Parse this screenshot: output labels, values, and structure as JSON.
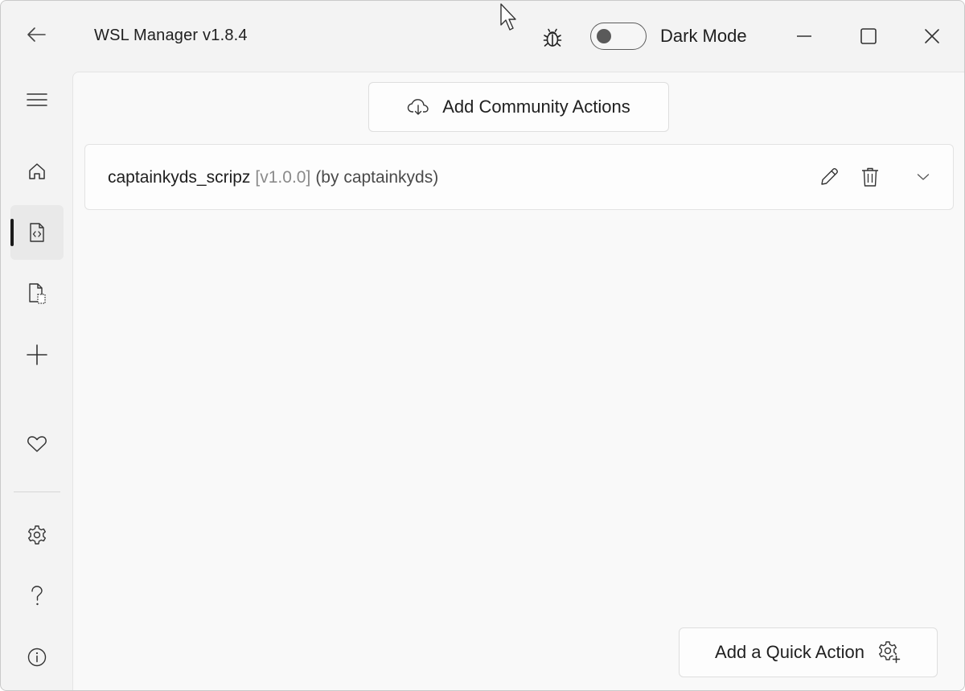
{
  "window": {
    "title": "WSL Manager v1.8.4"
  },
  "header": {
    "dark_mode_label": "Dark Mode",
    "dark_mode_on": false
  },
  "sidebar": {
    "items": [
      {
        "name": "menu",
        "icon": "hamburger-menu-icon"
      },
      {
        "name": "home",
        "icon": "home-icon"
      },
      {
        "name": "actions",
        "icon": "code-file-icon",
        "active": true
      },
      {
        "name": "templates",
        "icon": "file-copy-icon"
      },
      {
        "name": "create",
        "icon": "plus-icon"
      },
      {
        "name": "donate",
        "icon": "heart-icon"
      },
      {
        "name": "settings",
        "icon": "gear-icon"
      },
      {
        "name": "help",
        "icon": "question-icon"
      },
      {
        "name": "about",
        "icon": "info-icon"
      }
    ]
  },
  "main": {
    "community_button_label": "Add Community Actions",
    "repo": {
      "name": "captainkyds_scripz",
      "version": "[v1.0.0]",
      "author": "(by captainkyds)"
    },
    "quick_action_label": "Add a Quick Action"
  },
  "colors": {
    "background": "#f3f3f3",
    "content": "#f9f9f9",
    "card": "#fdfdfd",
    "indicator": "#1a1a1a"
  }
}
